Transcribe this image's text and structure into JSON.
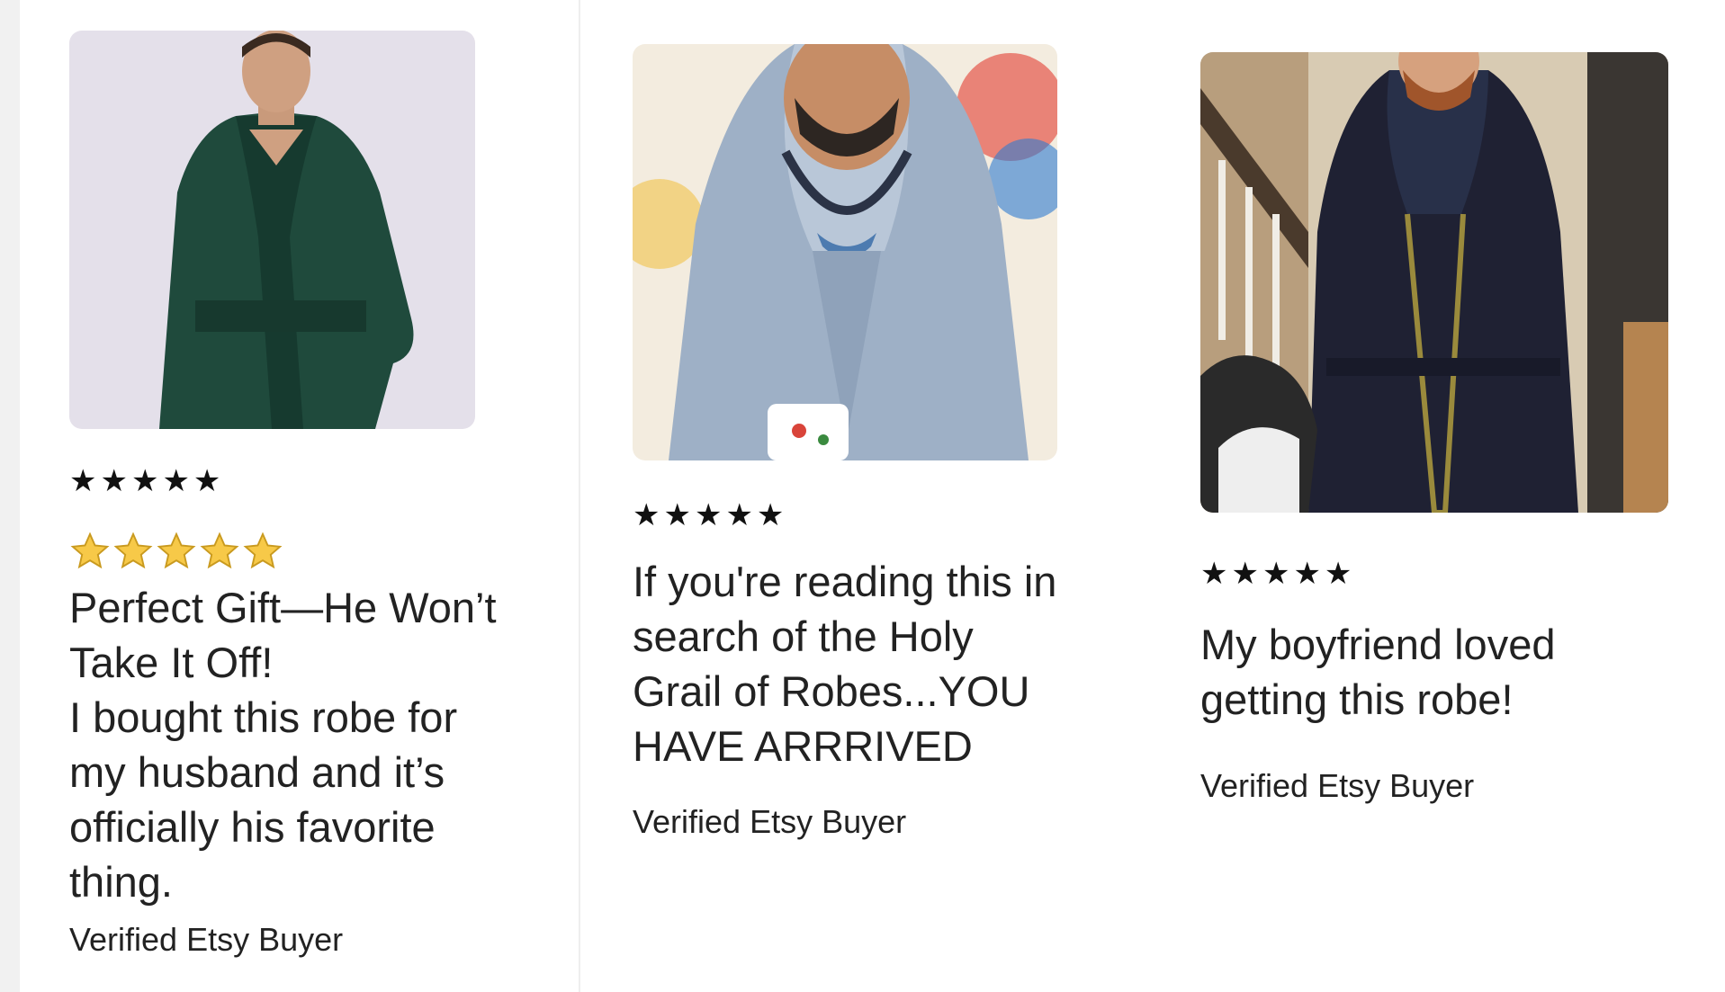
{
  "reviews": [
    {
      "rating_glyphs": "★★★★★",
      "emoji_rating": 5,
      "title_lines": [
        "Perfect Gift—He Won’t",
        "Take It Off!",
        "I bought this robe for",
        "my husband and it’s",
        "officially his favorite",
        "thing."
      ],
      "buyer": "Verified Etsy Buyer",
      "image_icon": "man-in-green-velvet-robe-photo"
    },
    {
      "rating_glyphs": "★★★★★",
      "title_lines": [
        "If you're reading this in",
        "search of the Holy",
        "Grail of Robes...YOU",
        "HAVE ARRRIVED"
      ],
      "buyer": "Verified Etsy Buyer",
      "image_icon": "watercolor-man-in-grey-hooded-robe-photo"
    },
    {
      "rating_glyphs": "★★★★★",
      "title_lines": [
        "My boyfriend loved",
        "getting this robe!"
      ],
      "buyer": "Verified Etsy Buyer",
      "image_icon": "man-in-black-robe-with-husky-photo"
    }
  ],
  "colors": {
    "text": "#222222",
    "star_black": "#111111",
    "star_gold": "#f7c948",
    "divider": "#eeeeee",
    "gutter": "#f1f1f1"
  }
}
